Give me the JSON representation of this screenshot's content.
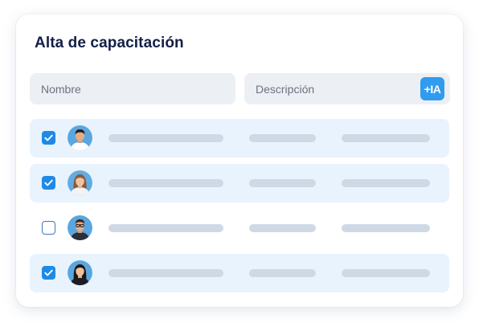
{
  "form": {
    "title": "Alta de capacitación",
    "name_placeholder": "Nombre",
    "description_placeholder": "Descripción",
    "ai_button_label": "+IA"
  },
  "rows": [
    {
      "checked": true,
      "avatar": "man-short-hair"
    },
    {
      "checked": true,
      "avatar": "woman-long-hair"
    },
    {
      "checked": false,
      "avatar": "man-with-glasses"
    },
    {
      "checked": true,
      "avatar": "woman-dark-hair"
    }
  ],
  "colors": {
    "title": "#121f48",
    "accent": "#2f9cef",
    "checkbox": "#1f8ae6",
    "row_highlight": "#e8f3fd",
    "skeleton": "#cfd9e6",
    "field_bg": "#eceff3"
  }
}
